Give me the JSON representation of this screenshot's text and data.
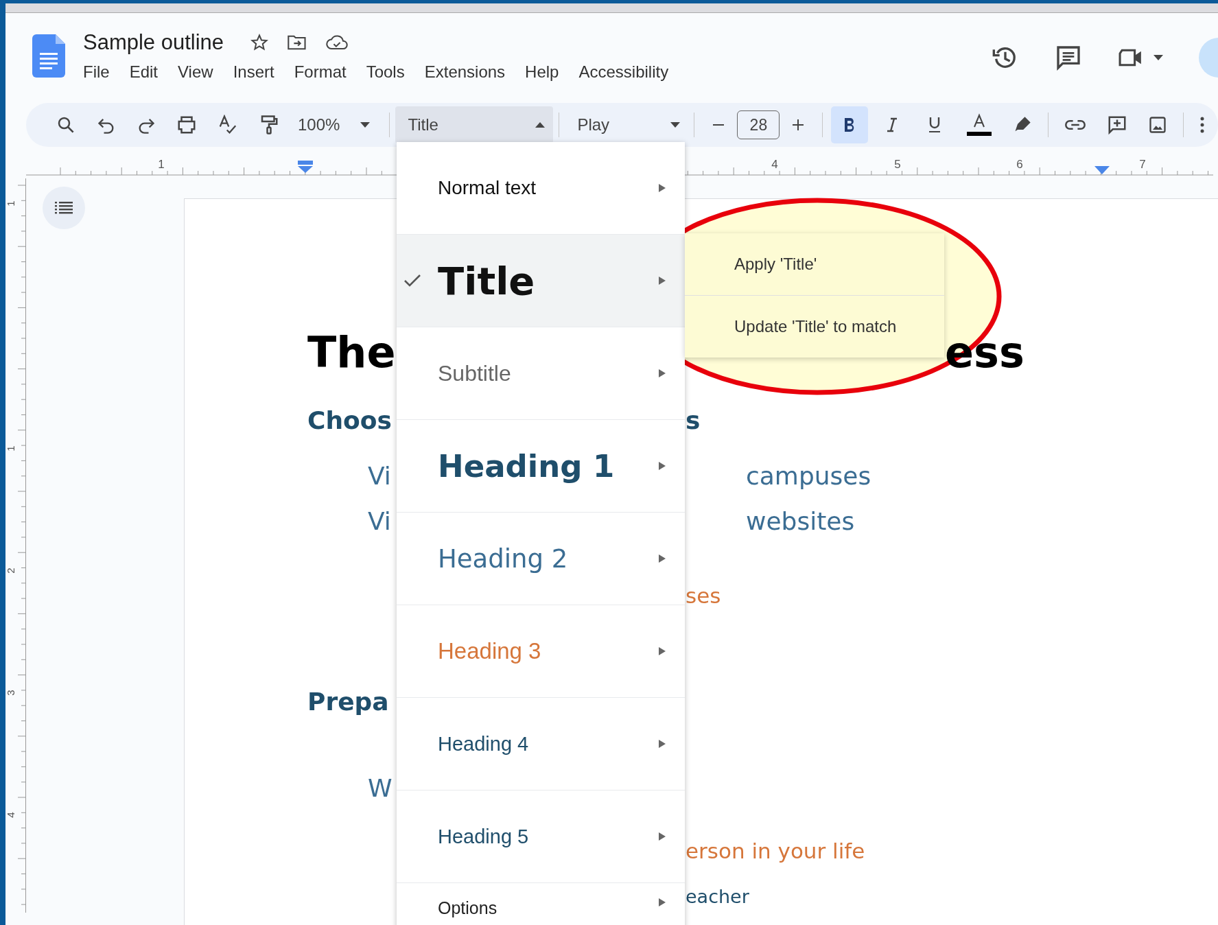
{
  "document": {
    "title": "Sample outline"
  },
  "menu_bar": [
    "File",
    "Edit",
    "View",
    "Insert",
    "Format",
    "Tools",
    "Extensions",
    "Help",
    "Accessibility"
  ],
  "toolbar": {
    "zoom": "100%",
    "style": "Title",
    "font": "Play",
    "font_size": "28",
    "bold": true,
    "italic": false,
    "underline": false
  },
  "ruler": {
    "labels": [
      "1",
      "4",
      "5",
      "6",
      "7"
    ]
  },
  "vertical_ruler": {
    "labels": [
      "1",
      "1",
      "2",
      "3",
      "4"
    ]
  },
  "page_lines": [
    {
      "kind": "title",
      "left": "The",
      "right": "ess"
    },
    {
      "kind": "heading1",
      "left": "Choos",
      "right": "s"
    },
    {
      "kind": "heading2",
      "left": "Vi",
      "right": "campuses"
    },
    {
      "kind": "heading2",
      "left": "Vi",
      "right": "websites"
    },
    {
      "kind": "heading3",
      "right": "ses"
    },
    {
      "kind": "heading1",
      "left": "Prepa"
    },
    {
      "kind": "heading2",
      "left": "W"
    },
    {
      "kind": "heading3",
      "right": "erson in your life"
    },
    {
      "kind": "heading4",
      "right": "eacher"
    }
  ],
  "style_menu": {
    "items": [
      {
        "kind": "normal",
        "label": "Normal text",
        "selected": false
      },
      {
        "kind": "title",
        "label": "Title",
        "selected": true
      },
      {
        "kind": "subtitle",
        "label": "Subtitle",
        "selected": false
      },
      {
        "kind": "heading1",
        "label": "Heading 1",
        "selected": false
      },
      {
        "kind": "heading2",
        "label": "Heading 2",
        "selected": false
      },
      {
        "kind": "heading3",
        "label": "Heading 3",
        "selected": false
      },
      {
        "kind": "heading4",
        "label": "Heading 4",
        "selected": false
      },
      {
        "kind": "heading5",
        "label": "Heading 5",
        "selected": false
      },
      {
        "kind": "options",
        "label": "Options",
        "selected": false
      }
    ],
    "submenu": [
      "Apply 'Title'",
      "Update 'Title' to match"
    ]
  }
}
